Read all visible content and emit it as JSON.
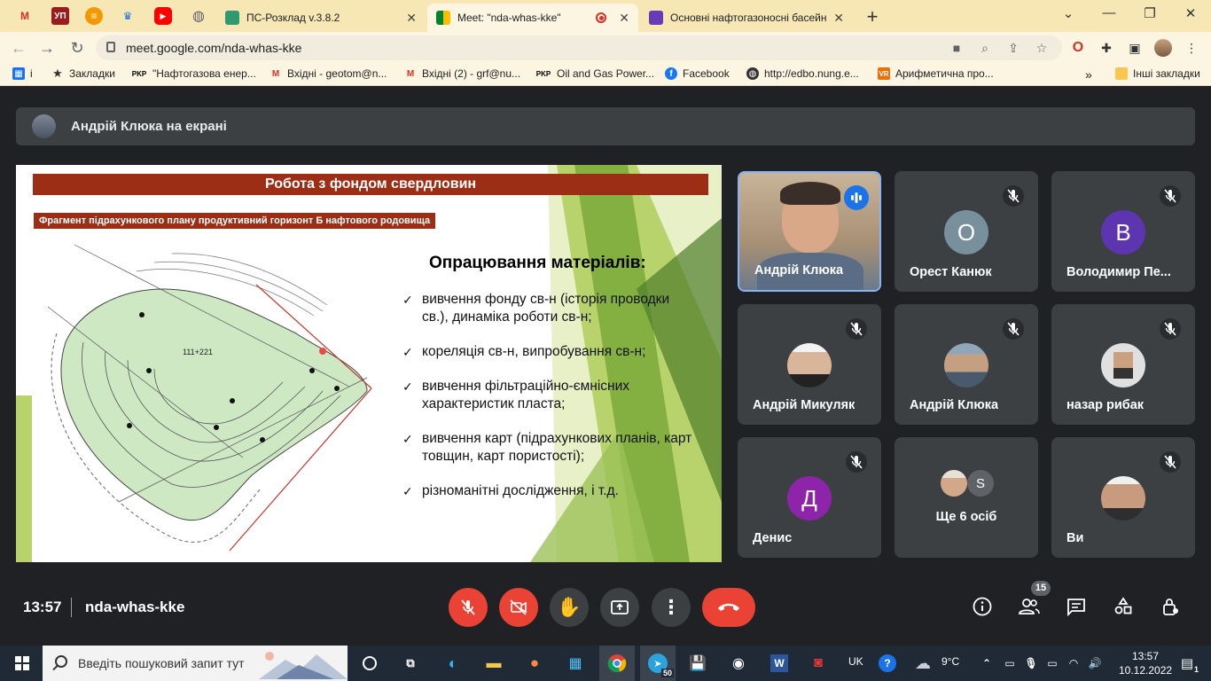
{
  "browser": {
    "tabs": [
      {
        "title": "ПС-Розклад v.3.8.2",
        "active": false
      },
      {
        "title": "Meet: \"nda-whas-kke\"",
        "active": true
      },
      {
        "title": "Основні нафтогазоносні басейн",
        "active": false
      }
    ],
    "pinned_icons": [
      "gmail-icon",
      "up-icon",
      "tabs-icon",
      "crest-icon",
      "youtube-icon",
      "globe-icon"
    ],
    "url": "meet.google.com/nda-whas-kke",
    "bookmarks": [
      {
        "label": "і",
        "icon": "apps-icon"
      },
      {
        "label": "Закладки",
        "icon": "star-icon"
      },
      {
        "label": "\"Нафтогазова енер...",
        "icon": "pkr-icon"
      },
      {
        "label": "Вхідні - geotom@n...",
        "icon": "gmail-icon"
      },
      {
        "label": "Вхідні (2) - grf@nu...",
        "icon": "gmail-icon"
      },
      {
        "label": "Oil and Gas Power...",
        "icon": "pkr-icon"
      },
      {
        "label": "Facebook",
        "icon": "facebook-icon"
      },
      {
        "label": "http://edbo.nung.e...",
        "icon": "globe-icon"
      },
      {
        "label": "Арифметична про...",
        "icon": "vr-icon"
      },
      {
        "label": "Інші закладки",
        "icon": "folder-icon"
      }
    ]
  },
  "meet": {
    "presenting": "Андрій Клюка на екрані",
    "time": "13:57",
    "meeting_code": "nda-whas-kke",
    "participant_count": "15",
    "slide": {
      "title": "Робота з фондом свердловин",
      "subtitle": "Фрагмент підрахункового плану продуктивний горизонт Б нафтового родовища",
      "map_label": "111+221",
      "heading": "Опрацювання матеріалів:",
      "bullets": [
        "вивчення фонду св-н (історія проводки св.), динаміка роботи св-н;",
        "кореляція св-н, випробування св-н;",
        "вивчення фільтраційно-ємнісних характеристик пласта;",
        "вивчення карт (підрахункових планів, карт товщин, карт пористості);",
        "різноманітні дослідження, і т.д."
      ]
    },
    "participants": [
      {
        "name": "Андрій Клюка",
        "initial": "",
        "color": "",
        "speaking": true
      },
      {
        "name": "Орест Канюк",
        "initial": "О",
        "color": "#78909c",
        "speaking": false
      },
      {
        "name": "Володимир Пе...",
        "initial": "В",
        "color": "#5e35b1",
        "speaking": false
      },
      {
        "name": "Андрій Микуляк",
        "initial": "",
        "color": "",
        "speaking": false
      },
      {
        "name": "Андрій Клюка",
        "initial": "",
        "color": "",
        "speaking": false
      },
      {
        "name": "назар рибак",
        "initial": "",
        "color": "",
        "speaking": false
      },
      {
        "name": "Денис",
        "initial": "Д",
        "color": "#8e24aa",
        "speaking": false
      },
      {
        "name": "Ще 6 осіб",
        "initial": "S",
        "color": "#5f6368",
        "speaking": false
      },
      {
        "name": "Ви",
        "initial": "",
        "color": "",
        "speaking": false
      }
    ]
  },
  "taskbar": {
    "search_placeholder": "Введіть пошуковий запит тут",
    "telegram_badge": "50",
    "language": "UK",
    "weather": "9°C",
    "time": "13:57",
    "date": "10.12.2022",
    "notifications": "1"
  }
}
